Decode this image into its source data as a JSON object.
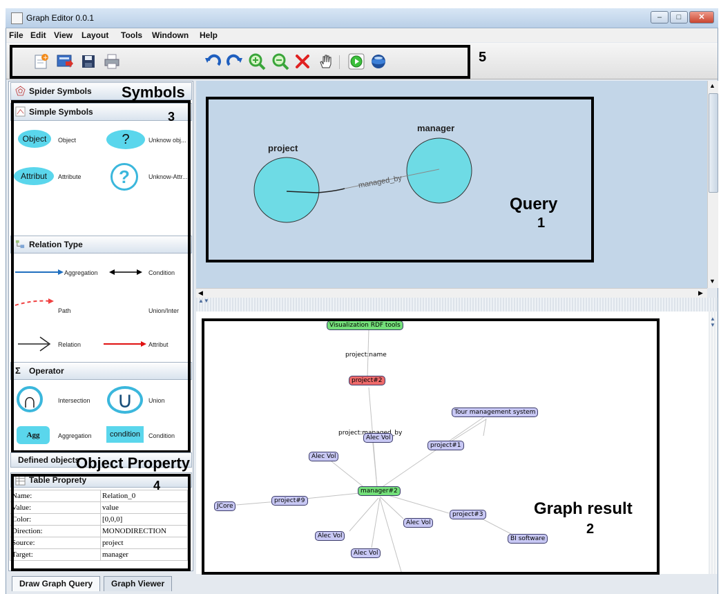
{
  "window": {
    "title": "Graph Editor 0.0.1",
    "buttons": [
      "–",
      "□",
      "✕"
    ]
  },
  "menu": [
    "File",
    "Edit",
    "View",
    "Layout",
    "Tools",
    "Windown",
    "Help"
  ],
  "toolbar_icons": [
    "new-document-icon",
    "import-icon",
    "save-icon",
    "print-icon",
    "undo-icon",
    "redo-icon",
    "zoom-in-icon",
    "zoom-out-icon",
    "delete-icon",
    "pan-hand-icon",
    "run-icon",
    "sphere-icon"
  ],
  "annotations": {
    "query_label": "Query",
    "query_num": "1",
    "result_label": "Graph result",
    "result_num": "2",
    "symbols_num": "3",
    "property_num": "4",
    "toolbar_num": "5",
    "symbols_label": "Symbols",
    "property_label": "Object Property"
  },
  "left_panel": {
    "spider_header": "Spider Symbols",
    "simple_header": "Simple Symbols",
    "simple_symbols": [
      {
        "glyph": "Object",
        "label": "Object"
      },
      {
        "glyph": "?",
        "label": "Unknow obj..."
      },
      {
        "glyph": "Attribut",
        "label": "Attribute"
      },
      {
        "glyph": "?",
        "label": "Unknow-Attr..."
      }
    ],
    "relation_header": "Relation Type",
    "relation_types": [
      "Aggregation",
      "Condition",
      "Path",
      "Union/Inter",
      "Relation",
      "Attribut"
    ],
    "operator_header": "Operator",
    "operators": [
      {
        "glyph": "∩",
        "label": "Intersection"
      },
      {
        "glyph": "∪",
        "label": "Union"
      },
      {
        "glyph": "Agg",
        "label": "Aggregation"
      },
      {
        "glyph": "condition",
        "label": "Condition"
      }
    ],
    "defined_objects": "Defined objects",
    "table_header": "Table Proprety",
    "table_rows": [
      [
        "Name:",
        "Relation_0"
      ],
      [
        "Value:",
        "value"
      ],
      [
        "Color:",
        "[0,0,0]"
      ],
      [
        "Direction:",
        "MONODIRECTION"
      ],
      [
        "Source:",
        "project"
      ],
      [
        "Target:",
        "manager"
      ]
    ]
  },
  "query": {
    "node1": "project",
    "node2": "manager",
    "edge": "managed_by"
  },
  "result": {
    "nodes": {
      "viz": "Visualization RDF tools",
      "project2": "project#2",
      "tour": "Tour management system",
      "alec_top": "Alec Vol",
      "project1": "project#1",
      "alec_left": "Alec Vol",
      "manager2": "manager#2",
      "jcore": "JCore",
      "project9": "project#9",
      "project3": "project#3",
      "alec_mid": "Alec Vol",
      "bi": "BI software",
      "alec_b1": "Alec Vol",
      "alec_b2": "Alec Vol"
    },
    "edge_labels": {
      "name": "project:name",
      "managed": "project:managed_by"
    }
  },
  "tabs": [
    "Draw Graph Query",
    "Graph Viewer"
  ]
}
